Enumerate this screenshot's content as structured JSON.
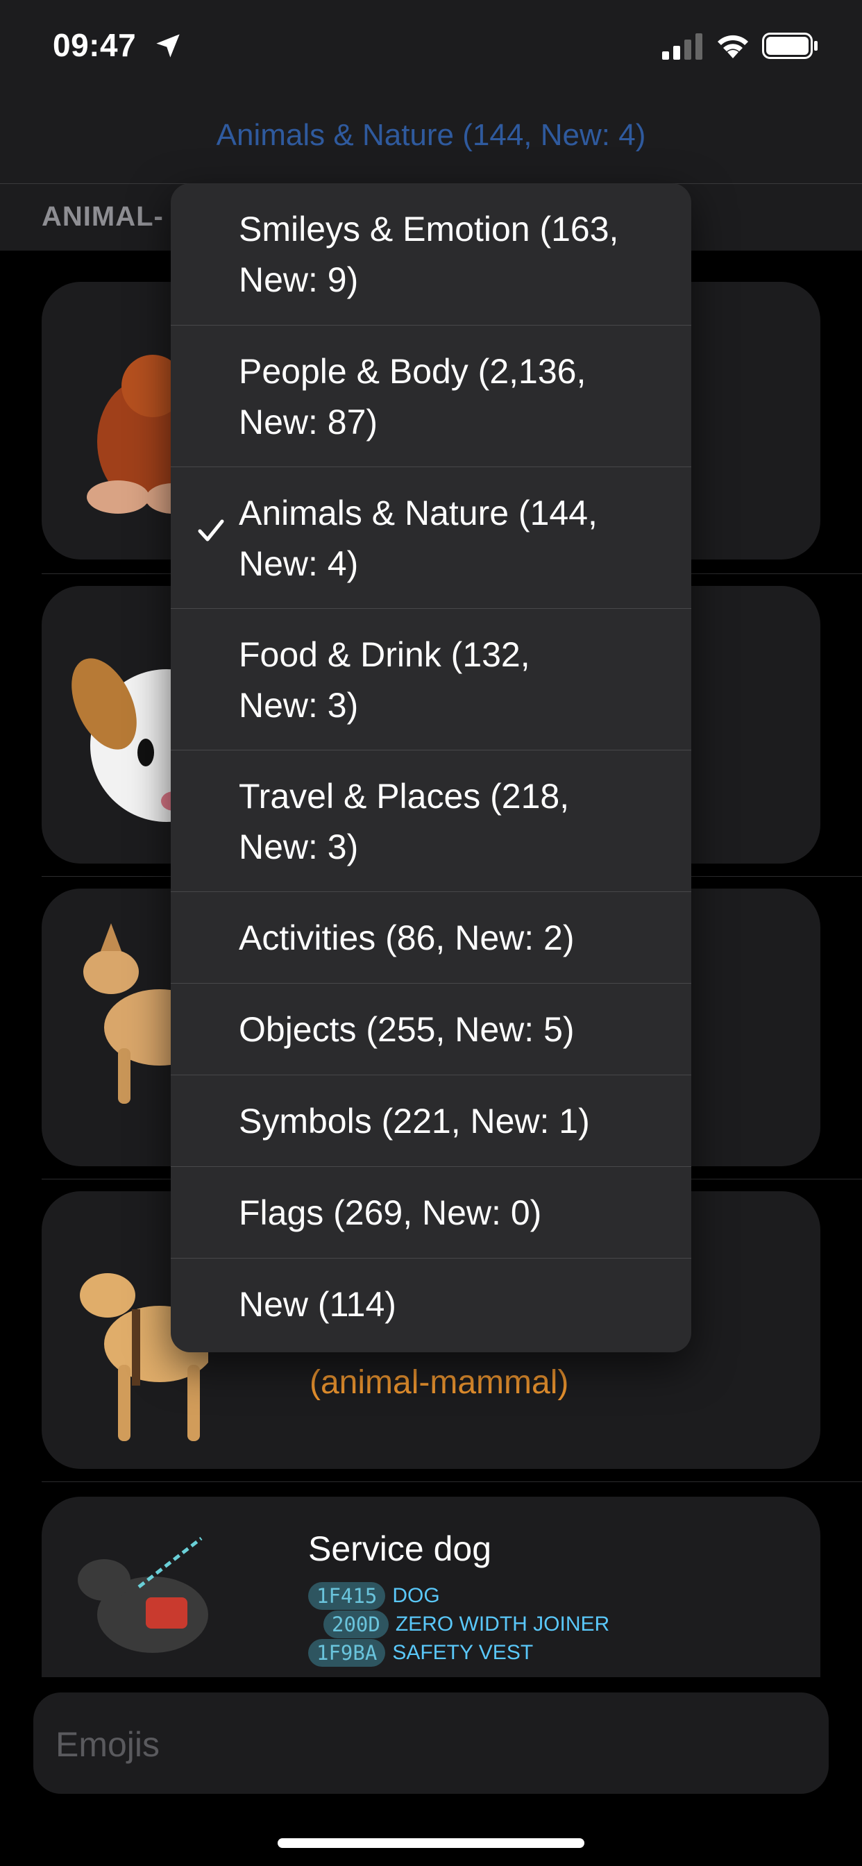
{
  "status_bar": {
    "time": "09:47"
  },
  "nav": {
    "title": "Animals & Nature (144, New: 4)"
  },
  "section": {
    "label": "ANIMAL-"
  },
  "menu": {
    "items": [
      {
        "line1": "Smileys & Emotion (163,",
        "line2": "New: 9)",
        "checked": false
      },
      {
        "line1": "People & Body (2,136,",
        "line2": "New: 87)",
        "checked": false
      },
      {
        "line1": "Animals & Nature (144,",
        "line2": "New: 4)",
        "checked": true
      },
      {
        "line1": "Food & Drink (132,",
        "line2": "New: 3)",
        "checked": false
      },
      {
        "line1": "Travel & Places (218,",
        "line2": "New: 3)",
        "checked": false
      },
      {
        "line1": "Activities (86, New: 2)",
        "checked": false
      },
      {
        "line1": "Objects (255, New: 5)",
        "checked": false
      },
      {
        "line1": "Symbols (221, New: 1)",
        "checked": false
      },
      {
        "line1": "Flags (269, New: 0)",
        "checked": false
      },
      {
        "line1": "New (114)",
        "checked": false
      }
    ]
  },
  "cards": {
    "guide_dog": {
      "category": "(animal-mammal)"
    },
    "service_dog": {
      "title": "Service dog",
      "codes": [
        {
          "code": "1F415",
          "name": "DOG"
        },
        {
          "code": "200D",
          "name": "ZERO WIDTH JOINER"
        },
        {
          "code": "1F9BA",
          "name": "SAFETY VEST"
        }
      ]
    }
  },
  "search": {
    "placeholder": "Emojis"
  },
  "colors": {
    "accent": "#2f5a9e",
    "category": "#e8922e",
    "code_text": "#5ac8fa"
  }
}
